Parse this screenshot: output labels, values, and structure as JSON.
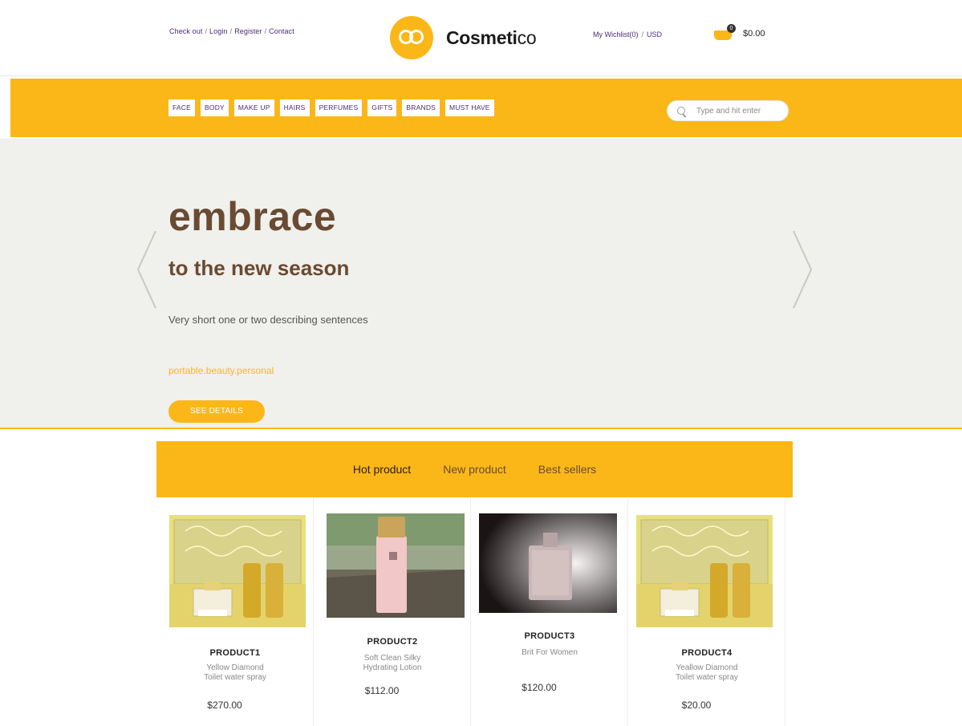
{
  "header": {
    "top_links": [
      "Check out",
      "Login",
      "Register",
      "Contact"
    ],
    "brand_bold": "Cosmeti",
    "brand_light": "co",
    "wishlist": "My Wichlist(0)",
    "currency": "USD",
    "cart_count": "0",
    "cart_total": "$0.00"
  },
  "nav": {
    "items": [
      "FACE",
      "BODY",
      "MAKE UP",
      "HAIRS",
      "PERFUMES",
      "GIFTS",
      "BRANDS",
      "MUST HAVE"
    ],
    "search_placeholder": "Type and hit enter"
  },
  "hero": {
    "title": "embrace",
    "subtitle": "to the new season",
    "description": "Very short one or two describing sentences",
    "tags": "portable.beauty.personal",
    "button": "SEE DETAILS"
  },
  "products": {
    "tabs": [
      "Hot product",
      "New product",
      "Best sellers"
    ],
    "items": [
      {
        "name": "PRODUCT1",
        "desc1": "Yellow Diamond",
        "desc2": "Toilet water spray",
        "price": "$270.00"
      },
      {
        "name": "PRODUCT2",
        "desc1": "Soft Clean Silky",
        "desc2": "Hydrating Lotion",
        "price": "$112.00"
      },
      {
        "name": "PRODUCT3",
        "desc1": "Brit For Women",
        "desc2": "",
        "price": "$120.00"
      },
      {
        "name": "PRODUCT4",
        "desc1": "Yeallow Diamond",
        "desc2": "Toilet water spray",
        "price": "$20.00"
      }
    ]
  },
  "colors": {
    "accent": "#fbb718",
    "brown": "#6a4a32",
    "purple": "#4b2a78",
    "hero_bg": "#f0f0ec"
  }
}
